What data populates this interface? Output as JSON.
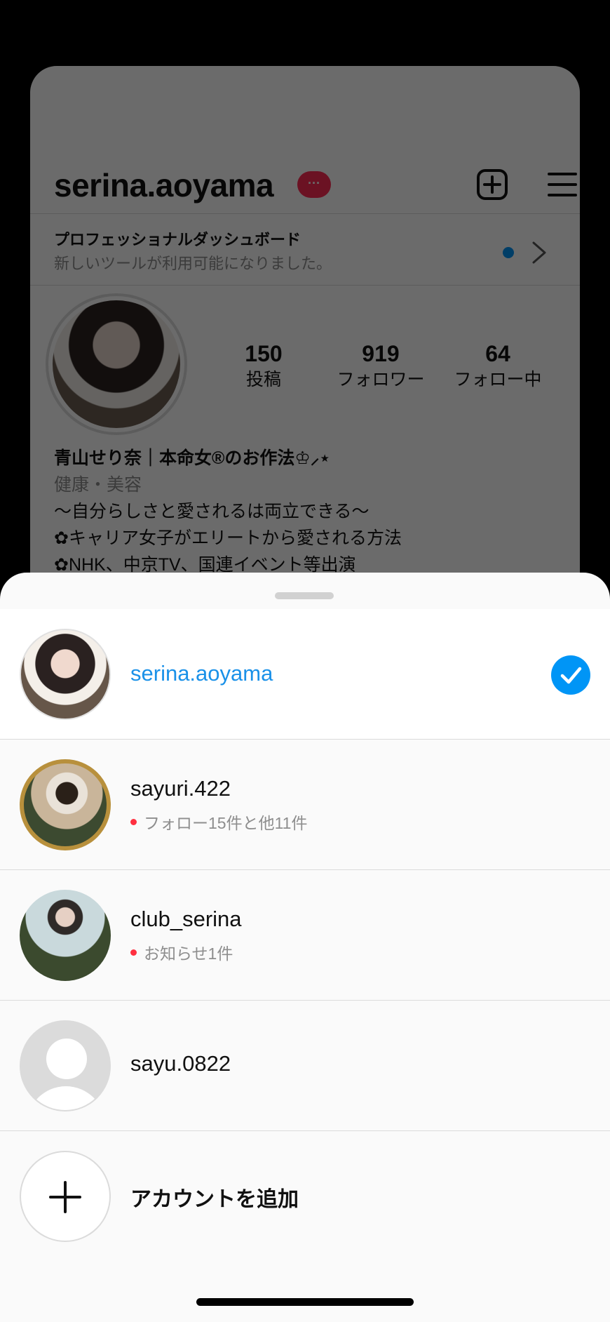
{
  "profile": {
    "username": "serina.aoyama",
    "notif_badge": "···",
    "dashboard_title": "プロフェッショナルダッシュボード",
    "dashboard_sub": "新しいツールが利用可能になりました。",
    "stats": [
      {
        "num": "150",
        "label": "投稿"
      },
      {
        "num": "919",
        "label": "フォロワー"
      },
      {
        "num": "64",
        "label": "フォロー中"
      }
    ],
    "bio_name": "青山せり奈｜本命女®のお作法♔⸝⋆",
    "bio_category": "健康・美容",
    "bio_line1": "〜自分らしさと愛されるは両立できる〜",
    "bio_line2": "✿キャリア女子がエリートから愛される方法",
    "bio_line3": "✿NHK、中京TV、国連イベント等出演"
  },
  "accounts": [
    {
      "name": "serina.aoyama",
      "sub": "",
      "selected": true
    },
    {
      "name": "sayuri.422",
      "sub": "フォロー15件と他11件"
    },
    {
      "name": "club_serina",
      "sub": "お知らせ1件"
    },
    {
      "name": "sayu.0822",
      "sub": ""
    }
  ],
  "add_account_label": "アカウントを追加",
  "colors": {
    "accent": "#0095f6",
    "current_account_text": "#1a91e8",
    "notif_dot": "#ff3040"
  },
  "icons": [
    "new-post-icon",
    "menu-icon",
    "chevron-right-icon",
    "checkmark-icon",
    "plus-icon",
    "default-avatar-icon"
  ]
}
